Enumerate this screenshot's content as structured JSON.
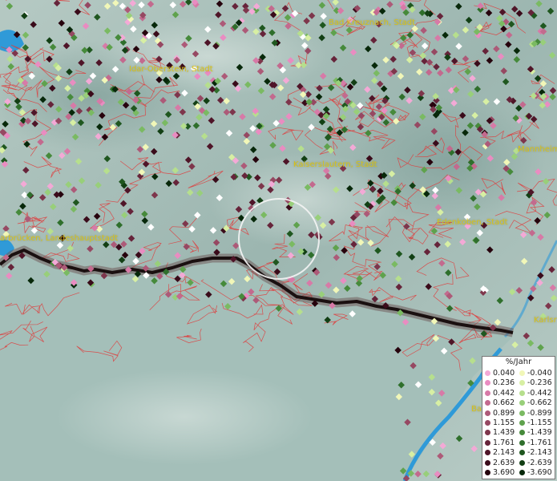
{
  "map": {
    "colors": {
      "terrain_light": "#aec3bd",
      "terrain_dark": "#7f9e98",
      "lowland": "#9fbbb5",
      "boundary_red": "#e03a3a",
      "border_black": "#1a1010",
      "water": "#2f9ad8",
      "city_label": "#d8c21a"
    },
    "city_labels": [
      "Bad Kreuznach, Stadt",
      "Idar-Oberstein, Stadt",
      "Kaiserslautern, Stadt",
      "Mannheim",
      "Edenkoben, Stadt",
      "arbrücken, Landeshauptstadt",
      "Karlsr",
      "Ba"
    ]
  },
  "legend": {
    "title": "%/Jahr",
    "positive": [
      {
        "value": "0.040",
        "color": "#f3a9d6"
      },
      {
        "value": "0.236",
        "color": "#e98cc1"
      },
      {
        "value": "0.442",
        "color": "#d77aa7"
      },
      {
        "value": "0.662",
        "color": "#c36a8e"
      },
      {
        "value": "0.899",
        "color": "#ad5a78"
      },
      {
        "value": "1.155",
        "color": "#964862"
      },
      {
        "value": "1.439",
        "color": "#7e364c"
      },
      {
        "value": "1.761",
        "color": "#66243a"
      },
      {
        "value": "2.143",
        "color": "#4f1528"
      },
      {
        "value": "2.639",
        "color": "#3a0b1a"
      },
      {
        "value": "3.690",
        "color": "#26030d"
      }
    ],
    "negative": [
      {
        "value": "-0.040",
        "color": "#f1f7b8"
      },
      {
        "value": "-0.236",
        "color": "#d7efa3"
      },
      {
        "value": "-0.442",
        "color": "#b6df8d"
      },
      {
        "value": "-0.662",
        "color": "#98cf7a"
      },
      {
        "value": "-0.899",
        "color": "#7aba62"
      },
      {
        "value": "-1.155",
        "color": "#5fa24d"
      },
      {
        "value": "-1.439",
        "color": "#468a3b"
      },
      {
        "value": "-1.761",
        "color": "#2f6f2c"
      },
      {
        "value": "-2.143",
        "color": "#1f571f"
      },
      {
        "value": "-2.639",
        "color": "#123f14"
      },
      {
        "value": "-3.690",
        "color": "#07280a"
      }
    ]
  }
}
